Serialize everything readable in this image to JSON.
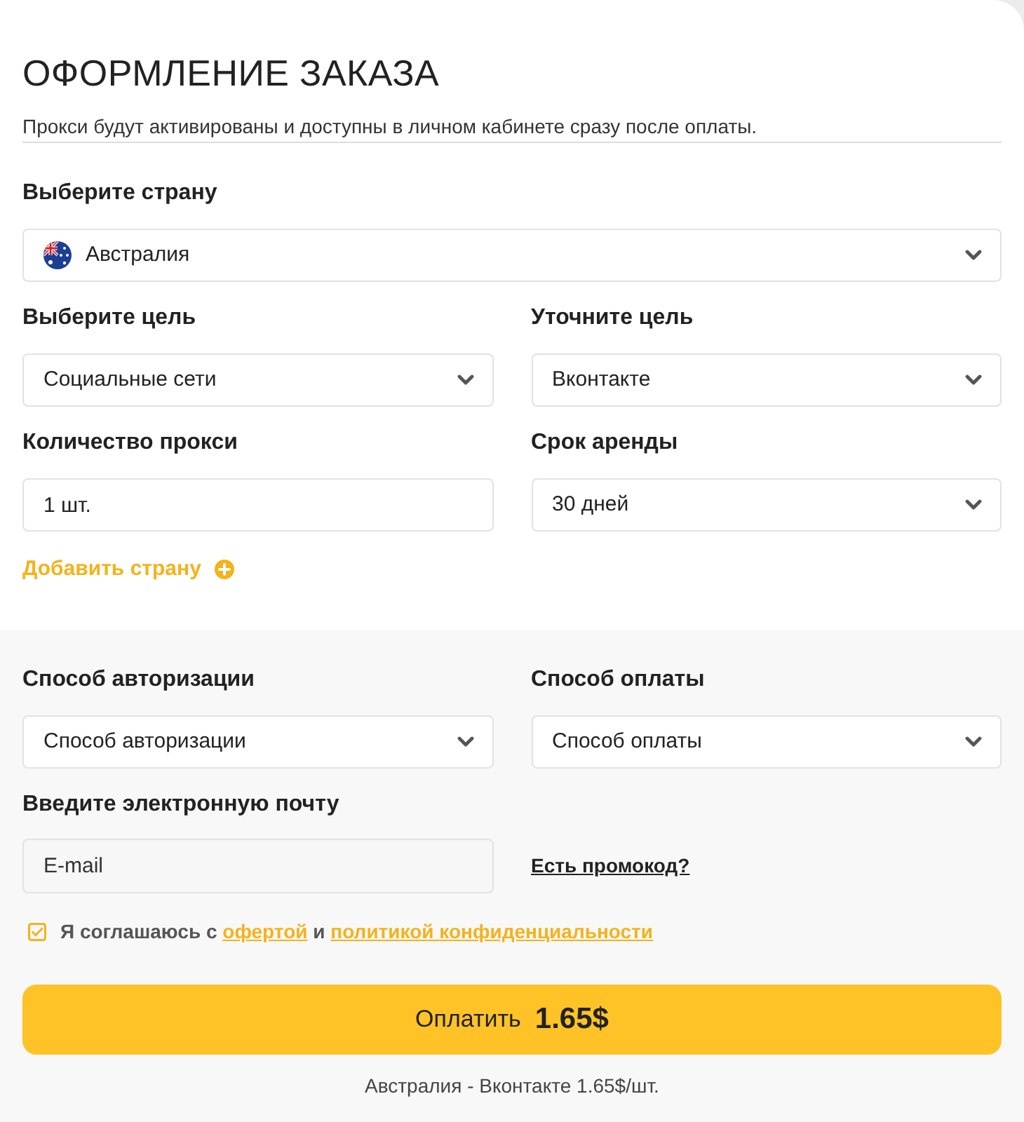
{
  "title": "ОФОРМЛЕНИЕ ЗАКАЗА",
  "subtitle": "Прокси будут активированы и доступны в личном кабинете сразу после оплаты.",
  "country": {
    "label": "Выберите страну",
    "value": "Австралия"
  },
  "fields": [
    {
      "kind": "select",
      "label": "Выберите цель",
      "value": "Социальные сети"
    },
    {
      "kind": "select",
      "label": "Уточните цель",
      "value": "Вконтакте"
    },
    {
      "kind": "input",
      "label": "Количество прокси",
      "value": "1 шт."
    },
    {
      "kind": "select",
      "label": "Срок аренды",
      "value": "30 дней"
    }
  ],
  "add_country": "Добавить страну",
  "payment_fields": [
    {
      "kind": "select",
      "label": "Способ авторизации",
      "value": "Способ авторизации"
    },
    {
      "kind": "select",
      "label": "Способ оплаты",
      "value": "Способ оплаты"
    }
  ],
  "email": {
    "label": "Введите электронную почту",
    "placeholder": "E-mail"
  },
  "promo_link": "Есть промокод?",
  "agreement": {
    "checked": true,
    "text": "Я соглашаюсь с",
    "offer_link": "офертой",
    "conjunction": "и",
    "privacy_link": "политикой конфиденциальности"
  },
  "pay_button": {
    "label": "Оплатить",
    "amount": "1.65$"
  },
  "summary": "Австралия - Вконтакте 1.65$/шт."
}
